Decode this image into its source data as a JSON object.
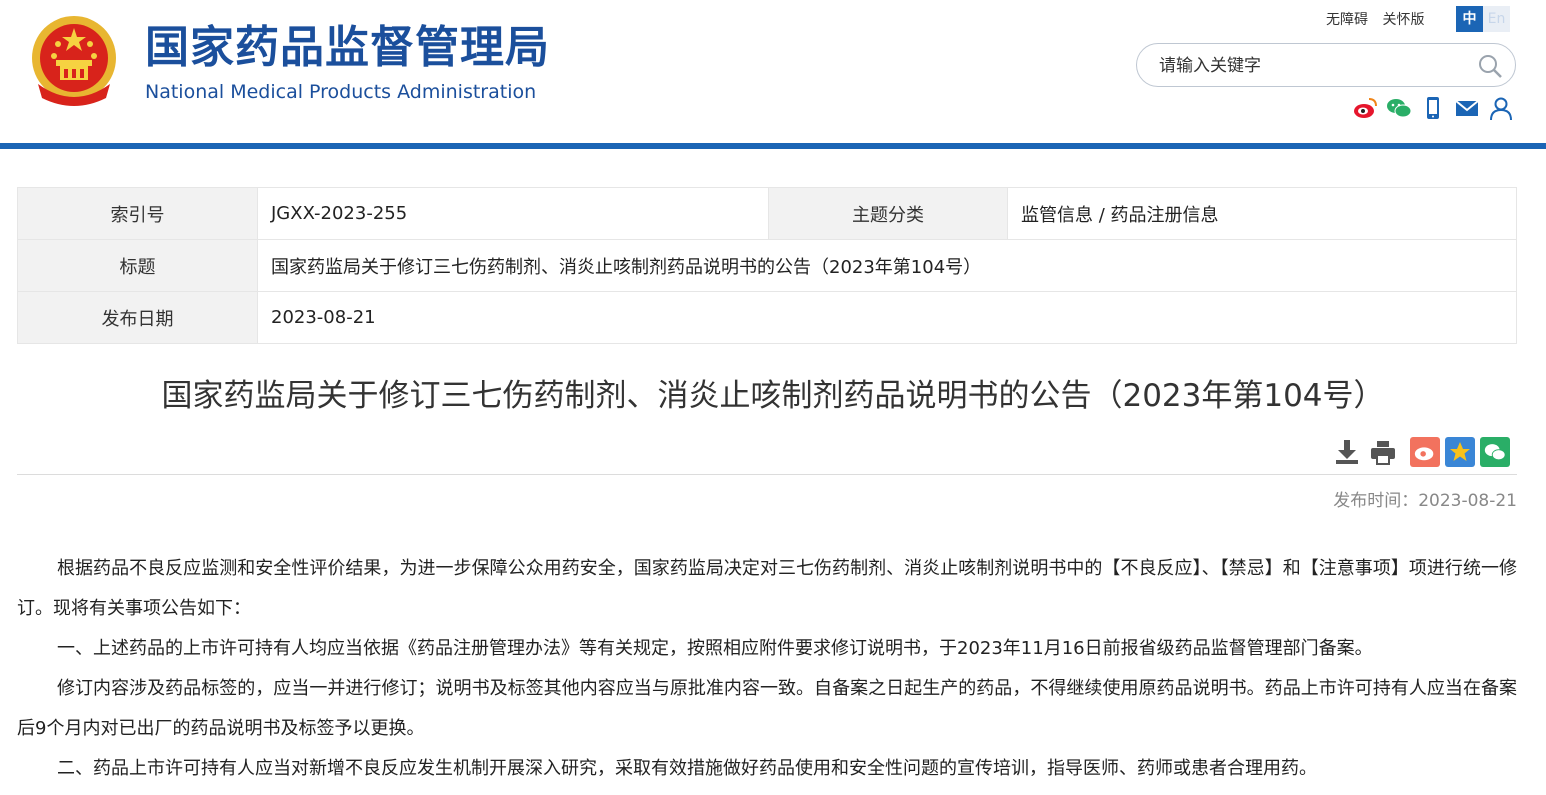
{
  "header": {
    "title_cn": "国家药品监督管理局",
    "title_en": "National Medical Products Administration",
    "links": {
      "accessibility": "无障碍",
      "care": "关怀版"
    },
    "lang": {
      "zh": "中",
      "en": "En"
    },
    "search": {
      "placeholder": "请输入关键字"
    },
    "social_icons": [
      "weibo-icon",
      "wechat-icon",
      "mobile-icon",
      "mail-icon",
      "user-icon"
    ]
  },
  "meta": {
    "index_label": "索引号",
    "index_value": "JGXX-2023-255",
    "topic_label": "主题分类",
    "topic_value": "监管信息 / 药品注册信息",
    "title_label": "标题",
    "title_value": "国家药监局关于修订三七伤药制剂、消炎止咳制剂药品说明书的公告（2023年第104号）",
    "date_label": "发布日期",
    "date_value": "2023-08-21"
  },
  "article": {
    "title": "国家药监局关于修订三七伤药制剂、消炎止咳制剂药品说明书的公告（2023年第104号）",
    "publish_time": "发布时间：2023-08-21",
    "paragraphs": [
      "根据药品不良反应监测和安全性评价结果，为进一步保障公众用药安全，国家药监局决定对三七伤药制剂、消炎止咳制剂说明书中的【不良反应】、【禁忌】和【注意事项】项进行统一修订。现将有关事项公告如下：",
      "一、上述药品的上市许可持有人均应当依据《药品注册管理办法》等有关规定，按照相应附件要求修订说明书，于2023年11月16日前报省级药品监督管理部门备案。",
      "修订内容涉及药品标签的，应当一并进行修订；说明书及标签其他内容应当与原批准内容一致。自备案之日起生产的药品，不得继续使用原药品说明书。药品上市许可持有人应当在备案后9个月内对已出厂的药品说明书及标签予以更换。",
      "二、药品上市许可持有人应当对新增不良反应发生机制开展深入研究，采取有效措施做好药品使用和安全性问题的宣传培训，指导医师、药师或患者合理用药。"
    ]
  },
  "colors": {
    "brand_blue": "#1b4f9c",
    "bar_blue": "#1b65b5"
  }
}
